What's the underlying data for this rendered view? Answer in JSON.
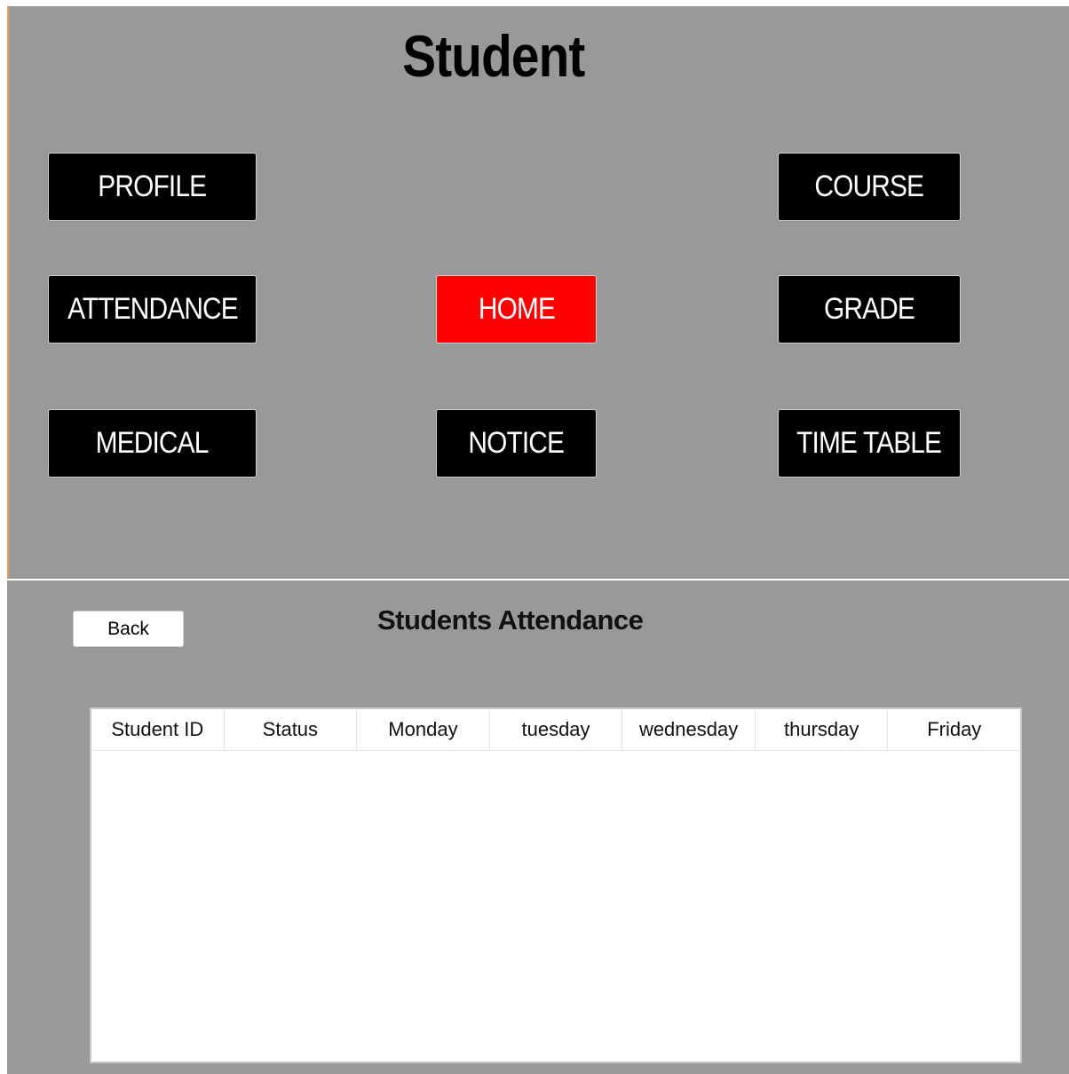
{
  "app": {
    "title": "Student"
  },
  "nav": {
    "profile": "PROFILE",
    "course": "COURSE",
    "attendance": "ATTENDANCE",
    "home": "HOME",
    "grade": "GRADE",
    "medical": "MEDICAL",
    "notice": "NOTICE",
    "timetable": "TIME TABLE"
  },
  "attendance_view": {
    "back_label": "Back",
    "title": "Students Attendance",
    "columns": [
      "Student ID",
      "Status",
      "Monday",
      "tuesday",
      "wednesday",
      "thursday",
      "Friday"
    ],
    "rows": []
  },
  "colors": {
    "panel_bg": "#999999",
    "button_bg": "#000000",
    "button_active_bg": "#ff0000",
    "button_text": "#ffffff"
  }
}
